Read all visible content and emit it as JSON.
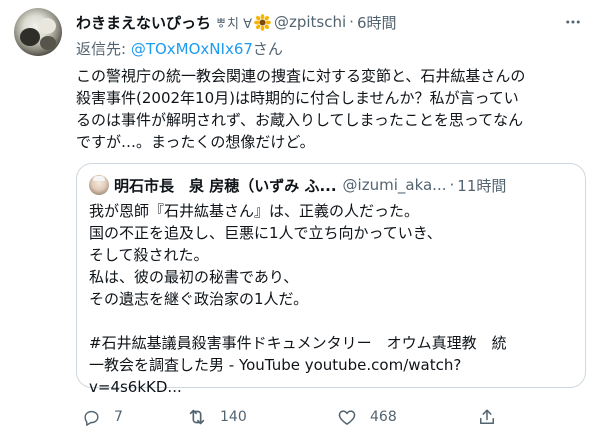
{
  "tweet": {
    "author": {
      "display_name": "わきまえないぴっち",
      "verified_label": "ㅹ치 ∀",
      "handle": "@zpitschi",
      "time": "6時間",
      "separator": "·"
    },
    "reply": {
      "prefix": "返信先: ",
      "mention": "@TOxMOxNIx67",
      "suffix": "さん"
    },
    "text": "この警視庁の統一教会関連の捜査に対する変節と、石井紘基さんの\n殺害事件(2002年10月)は時期的に付合しませんか？私が言ってい\nるのは事件が解明されず、お蔵入りしてしまったことを思ってなん\nですが…。まったくの想像だけど。",
    "quote": {
      "name": "明石市長　泉 房穂（いずみ ふ...",
      "handle": "@izumi_aka...",
      "separator": "·",
      "time": "11時間",
      "text": "我が恩師『石井紘基さん』は、正義の人だった。\n国の不正を追及し、巨悪に1人で立ち向かっていき、\nそして殺された。\n私は、彼の最初の秘書であり、\nその遺志を継ぐ政治家の1人だ。\n\n#石井紘基議員殺害事件ドキュメンタリー　オウム真理教　統\n一教会を調査した男 - YouTube youtube.com/watch?\nv=4s6kKD..."
    },
    "actions": {
      "reply_count": "7",
      "retweet_count": "140",
      "like_count": "468"
    },
    "colors": {
      "accent": "#1d9bf0",
      "muted": "#536471",
      "text": "#0f1419",
      "border": "#cfd9de"
    },
    "icons": [
      "more-icon",
      "sunflower-icon",
      "reply-icon",
      "retweet-icon",
      "like-icon",
      "share-icon"
    ]
  }
}
